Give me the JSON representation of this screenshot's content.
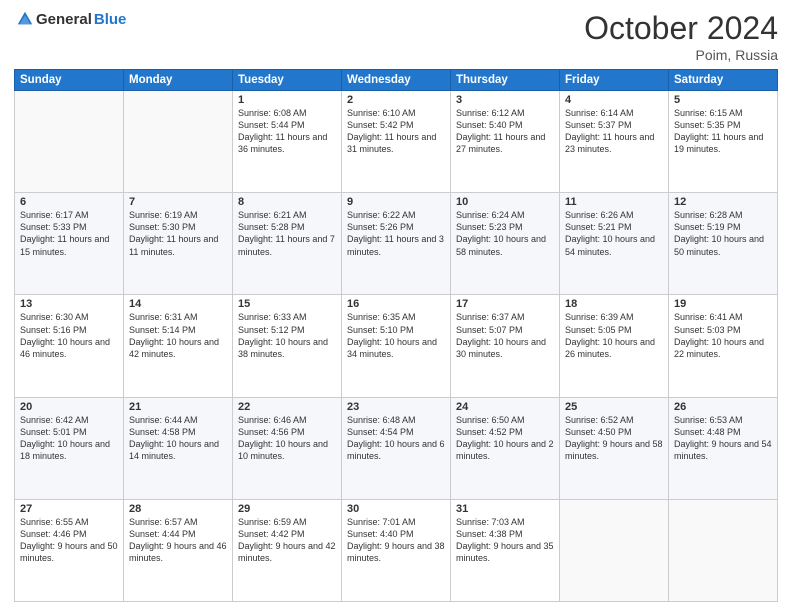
{
  "header": {
    "logo_general": "General",
    "logo_blue": "Blue",
    "month_title": "October 2024",
    "location": "Poim, Russia"
  },
  "days_of_week": [
    "Sunday",
    "Monday",
    "Tuesday",
    "Wednesday",
    "Thursday",
    "Friday",
    "Saturday"
  ],
  "weeks": [
    [
      {
        "day": "",
        "sunrise": "",
        "sunset": "",
        "daylight": ""
      },
      {
        "day": "",
        "sunrise": "",
        "sunset": "",
        "daylight": ""
      },
      {
        "day": "1",
        "sunrise": "Sunrise: 6:08 AM",
        "sunset": "Sunset: 5:44 PM",
        "daylight": "Daylight: 11 hours and 36 minutes."
      },
      {
        "day": "2",
        "sunrise": "Sunrise: 6:10 AM",
        "sunset": "Sunset: 5:42 PM",
        "daylight": "Daylight: 11 hours and 31 minutes."
      },
      {
        "day": "3",
        "sunrise": "Sunrise: 6:12 AM",
        "sunset": "Sunset: 5:40 PM",
        "daylight": "Daylight: 11 hours and 27 minutes."
      },
      {
        "day": "4",
        "sunrise": "Sunrise: 6:14 AM",
        "sunset": "Sunset: 5:37 PM",
        "daylight": "Daylight: 11 hours and 23 minutes."
      },
      {
        "day": "5",
        "sunrise": "Sunrise: 6:15 AM",
        "sunset": "Sunset: 5:35 PM",
        "daylight": "Daylight: 11 hours and 19 minutes."
      }
    ],
    [
      {
        "day": "6",
        "sunrise": "Sunrise: 6:17 AM",
        "sunset": "Sunset: 5:33 PM",
        "daylight": "Daylight: 11 hours and 15 minutes."
      },
      {
        "day": "7",
        "sunrise": "Sunrise: 6:19 AM",
        "sunset": "Sunset: 5:30 PM",
        "daylight": "Daylight: 11 hours and 11 minutes."
      },
      {
        "day": "8",
        "sunrise": "Sunrise: 6:21 AM",
        "sunset": "Sunset: 5:28 PM",
        "daylight": "Daylight: 11 hours and 7 minutes."
      },
      {
        "day": "9",
        "sunrise": "Sunrise: 6:22 AM",
        "sunset": "Sunset: 5:26 PM",
        "daylight": "Daylight: 11 hours and 3 minutes."
      },
      {
        "day": "10",
        "sunrise": "Sunrise: 6:24 AM",
        "sunset": "Sunset: 5:23 PM",
        "daylight": "Daylight: 10 hours and 58 minutes."
      },
      {
        "day": "11",
        "sunrise": "Sunrise: 6:26 AM",
        "sunset": "Sunset: 5:21 PM",
        "daylight": "Daylight: 10 hours and 54 minutes."
      },
      {
        "day": "12",
        "sunrise": "Sunrise: 6:28 AM",
        "sunset": "Sunset: 5:19 PM",
        "daylight": "Daylight: 10 hours and 50 minutes."
      }
    ],
    [
      {
        "day": "13",
        "sunrise": "Sunrise: 6:30 AM",
        "sunset": "Sunset: 5:16 PM",
        "daylight": "Daylight: 10 hours and 46 minutes."
      },
      {
        "day": "14",
        "sunrise": "Sunrise: 6:31 AM",
        "sunset": "Sunset: 5:14 PM",
        "daylight": "Daylight: 10 hours and 42 minutes."
      },
      {
        "day": "15",
        "sunrise": "Sunrise: 6:33 AM",
        "sunset": "Sunset: 5:12 PM",
        "daylight": "Daylight: 10 hours and 38 minutes."
      },
      {
        "day": "16",
        "sunrise": "Sunrise: 6:35 AM",
        "sunset": "Sunset: 5:10 PM",
        "daylight": "Daylight: 10 hours and 34 minutes."
      },
      {
        "day": "17",
        "sunrise": "Sunrise: 6:37 AM",
        "sunset": "Sunset: 5:07 PM",
        "daylight": "Daylight: 10 hours and 30 minutes."
      },
      {
        "day": "18",
        "sunrise": "Sunrise: 6:39 AM",
        "sunset": "Sunset: 5:05 PM",
        "daylight": "Daylight: 10 hours and 26 minutes."
      },
      {
        "day": "19",
        "sunrise": "Sunrise: 6:41 AM",
        "sunset": "Sunset: 5:03 PM",
        "daylight": "Daylight: 10 hours and 22 minutes."
      }
    ],
    [
      {
        "day": "20",
        "sunrise": "Sunrise: 6:42 AM",
        "sunset": "Sunset: 5:01 PM",
        "daylight": "Daylight: 10 hours and 18 minutes."
      },
      {
        "day": "21",
        "sunrise": "Sunrise: 6:44 AM",
        "sunset": "Sunset: 4:58 PM",
        "daylight": "Daylight: 10 hours and 14 minutes."
      },
      {
        "day": "22",
        "sunrise": "Sunrise: 6:46 AM",
        "sunset": "Sunset: 4:56 PM",
        "daylight": "Daylight: 10 hours and 10 minutes."
      },
      {
        "day": "23",
        "sunrise": "Sunrise: 6:48 AM",
        "sunset": "Sunset: 4:54 PM",
        "daylight": "Daylight: 10 hours and 6 minutes."
      },
      {
        "day": "24",
        "sunrise": "Sunrise: 6:50 AM",
        "sunset": "Sunset: 4:52 PM",
        "daylight": "Daylight: 10 hours and 2 minutes."
      },
      {
        "day": "25",
        "sunrise": "Sunrise: 6:52 AM",
        "sunset": "Sunset: 4:50 PM",
        "daylight": "Daylight: 9 hours and 58 minutes."
      },
      {
        "day": "26",
        "sunrise": "Sunrise: 6:53 AM",
        "sunset": "Sunset: 4:48 PM",
        "daylight": "Daylight: 9 hours and 54 minutes."
      }
    ],
    [
      {
        "day": "27",
        "sunrise": "Sunrise: 6:55 AM",
        "sunset": "Sunset: 4:46 PM",
        "daylight": "Daylight: 9 hours and 50 minutes."
      },
      {
        "day": "28",
        "sunrise": "Sunrise: 6:57 AM",
        "sunset": "Sunset: 4:44 PM",
        "daylight": "Daylight: 9 hours and 46 minutes."
      },
      {
        "day": "29",
        "sunrise": "Sunrise: 6:59 AM",
        "sunset": "Sunset: 4:42 PM",
        "daylight": "Daylight: 9 hours and 42 minutes."
      },
      {
        "day": "30",
        "sunrise": "Sunrise: 7:01 AM",
        "sunset": "Sunset: 4:40 PM",
        "daylight": "Daylight: 9 hours and 38 minutes."
      },
      {
        "day": "31",
        "sunrise": "Sunrise: 7:03 AM",
        "sunset": "Sunset: 4:38 PM",
        "daylight": "Daylight: 9 hours and 35 minutes."
      },
      {
        "day": "",
        "sunrise": "",
        "sunset": "",
        "daylight": ""
      },
      {
        "day": "",
        "sunrise": "",
        "sunset": "",
        "daylight": ""
      }
    ]
  ]
}
